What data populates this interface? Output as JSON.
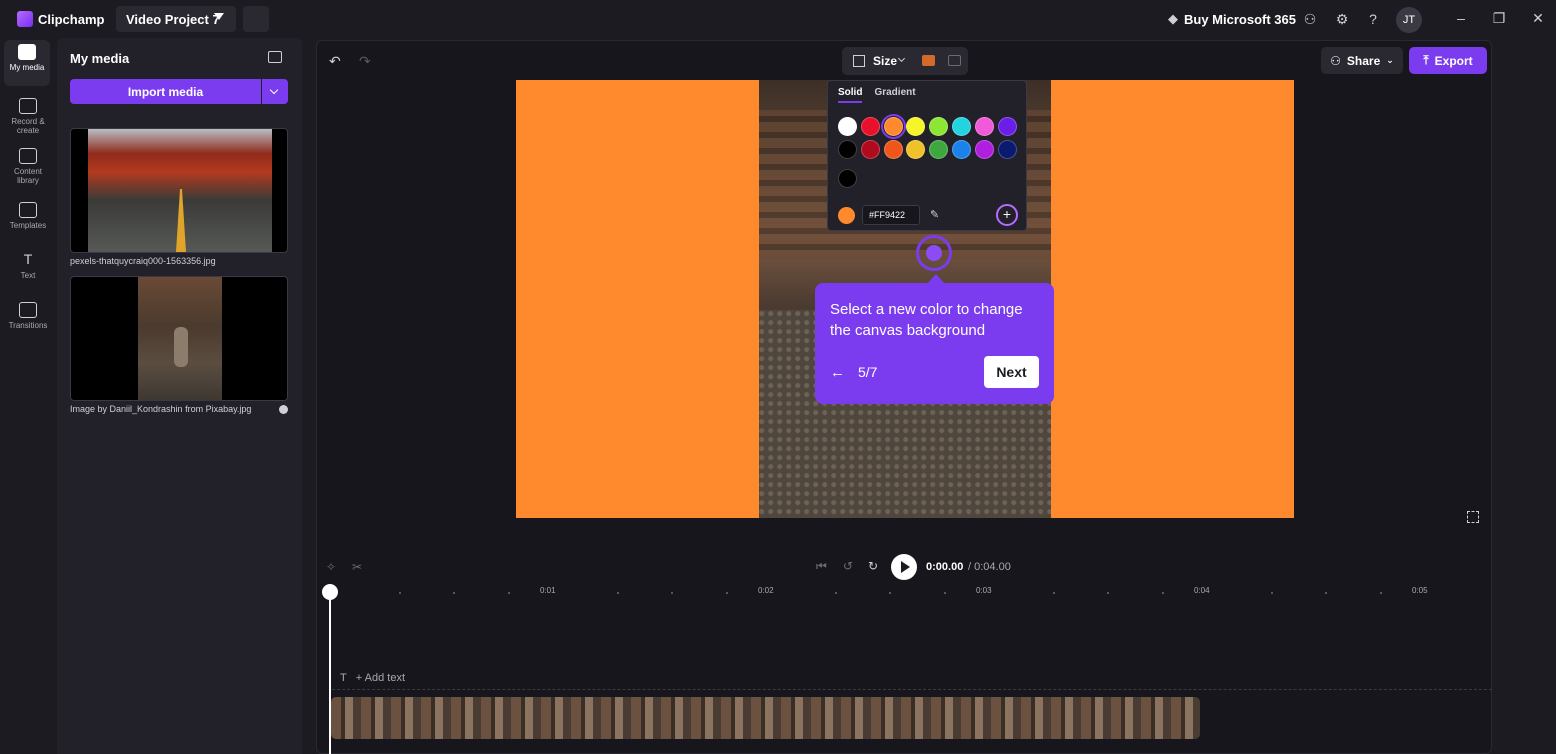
{
  "titlebar": {
    "app_name": "Clipchamp",
    "project_name": "Video Project 7",
    "buy_label": "Buy Microsoft 365",
    "avatar_initials": "JT"
  },
  "rail": {
    "items": [
      {
        "label": "My media",
        "active": true
      },
      {
        "label": "Record & create"
      },
      {
        "label": "Content library"
      },
      {
        "label": "Templates"
      },
      {
        "label": "Text"
      },
      {
        "label": "Transitions"
      }
    ]
  },
  "media_panel": {
    "title": "My media",
    "import_label": "Import media",
    "items": [
      {
        "filename": "pexels-thatquycraiq000-1563356.jpg"
      },
      {
        "filename": "Image by Daniil_Kondrashin from Pixabay.jpg"
      }
    ]
  },
  "editor": {
    "size_label": "Size",
    "share_label": "Share",
    "export_label": "Export",
    "canvas_color": "#FF8A2E"
  },
  "color_picker": {
    "tabs": [
      "Solid",
      "Gradient"
    ],
    "active_tab": "Solid",
    "hex_value": "#FF9422",
    "swatches_row1": [
      "#ffffff",
      "#e8102a",
      "#ff8a2e",
      "#f5f52a",
      "#8ce632",
      "#22d3e0",
      "#f05ad8",
      "#6a1ee8"
    ],
    "swatches_row2": [
      "#000000",
      "#b00a1e",
      "#f0561a",
      "#f0c22a",
      "#3ea83e",
      "#1a82e8",
      "#b01ee0",
      "#0a1a6e"
    ],
    "swatches_row3": [
      "#000000"
    ],
    "selected_swatch": "#ff8a2e"
  },
  "callout": {
    "text": "Select a new color to change the canvas background",
    "step": "5/7",
    "next_label": "Next"
  },
  "timeline": {
    "current_time": "0:00.00",
    "total_time": "/ 0:04.00",
    "ticks": [
      "0:01",
      "0:02",
      "0:03",
      "0:04",
      "0:05"
    ],
    "add_text_label": "+ Add text"
  },
  "colors": {
    "accent": "#7B3CF0",
    "background": "#1C1B22",
    "panel": "#22212A"
  }
}
